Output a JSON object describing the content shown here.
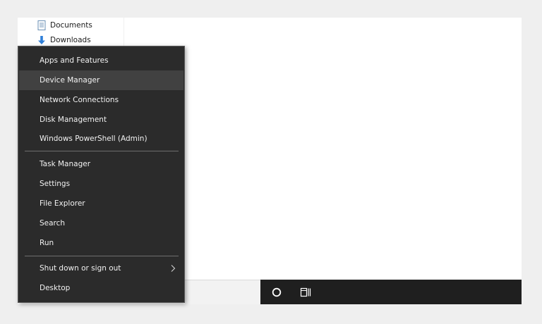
{
  "explorer": {
    "nav_items": [
      {
        "label": "Documents",
        "icon": "documents-icon"
      },
      {
        "label": "Downloads",
        "icon": "downloads-icon"
      }
    ]
  },
  "winx_menu": {
    "groups": [
      [
        {
          "label": "Apps and Features"
        },
        {
          "label": "Device Manager",
          "highlighted": true
        },
        {
          "label": "Network Connections"
        },
        {
          "label": "Disk Management"
        },
        {
          "label": "Windows PowerShell (Admin)"
        }
      ],
      [
        {
          "label": "Task Manager"
        },
        {
          "label": "Settings"
        },
        {
          "label": "File Explorer"
        },
        {
          "label": "Search"
        },
        {
          "label": "Run"
        }
      ],
      [
        {
          "label": "Shut down or sign out",
          "has_submenu": true
        },
        {
          "label": "Desktop"
        }
      ]
    ]
  },
  "taskbar": {
    "buttons": [
      {
        "icon": "cortana-circle-icon"
      },
      {
        "icon": "task-view-icon"
      }
    ]
  },
  "colors": {
    "menu_bg": "#2b2b2b",
    "menu_hover": "#414141",
    "taskbar_bg": "#1f1f1f",
    "menu_text": "#f2f2f2"
  }
}
